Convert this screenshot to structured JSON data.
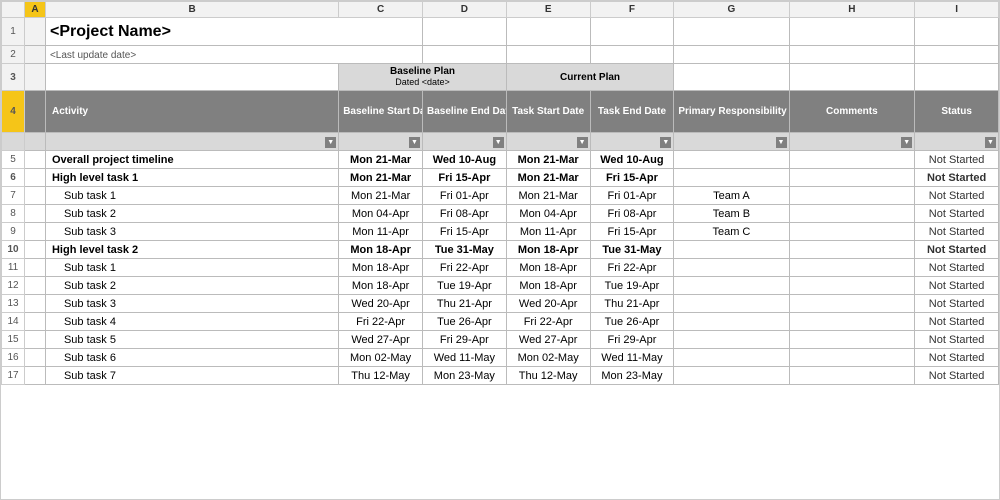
{
  "title": "<Project Name>",
  "lastUpdate": "<Last update date>",
  "headers": {
    "colA": "A",
    "colB": "B",
    "colC": "C",
    "colD": "D",
    "colE": "E",
    "colF": "F",
    "colG": "G",
    "colH": "H",
    "colI": "I"
  },
  "planHeaders": {
    "baselinePlan": "Baseline Plan",
    "baselineDated": "Dated <date>",
    "currentPlan": "Current Plan"
  },
  "columnHeaders": {
    "activity": "Activity",
    "baselineStart": "Baseline Start Date",
    "baselineEnd": "Baseline End Date",
    "taskStart": "Task Start Date",
    "taskEnd": "Task End Date",
    "primaryResp": "Primary Responsibility",
    "comments": "Comments",
    "status": "Status"
  },
  "rows": [
    {
      "num": "5",
      "activity": "Overall project timeline",
      "baselineStart": "Mon 21-Mar",
      "baselineEnd": "Wed 10-Aug",
      "taskStart": "Mon 21-Mar",
      "taskEnd": "Wed 10-Aug",
      "responsibility": "",
      "comments": "",
      "status": "Not Started",
      "type": "overall"
    },
    {
      "num": "6",
      "activity": "High level task 1",
      "baselineStart": "Mon 21-Mar",
      "baselineEnd": "Fri 15-Apr",
      "taskStart": "Mon 21-Mar",
      "taskEnd": "Fri 15-Apr",
      "responsibility": "",
      "comments": "",
      "status": "Not Started",
      "type": "highlevel"
    },
    {
      "num": "7",
      "activity": "Sub task 1",
      "baselineStart": "Mon 21-Mar",
      "baselineEnd": "Fri 01-Apr",
      "taskStart": "Mon 21-Mar",
      "taskEnd": "Fri 01-Apr",
      "responsibility": "Team A",
      "comments": "",
      "status": "Not Started",
      "type": "subtask"
    },
    {
      "num": "8",
      "activity": "Sub task 2",
      "baselineStart": "Mon 04-Apr",
      "baselineEnd": "Fri 08-Apr",
      "taskStart": "Mon 04-Apr",
      "taskEnd": "Fri 08-Apr",
      "responsibility": "Team B",
      "comments": "",
      "status": "Not Started",
      "type": "subtask"
    },
    {
      "num": "9",
      "activity": "Sub task 3",
      "baselineStart": "Mon 11-Apr",
      "baselineEnd": "Fri 15-Apr",
      "taskStart": "Mon 11-Apr",
      "taskEnd": "Fri 15-Apr",
      "responsibility": "Team C",
      "comments": "",
      "status": "Not Started",
      "type": "subtask"
    },
    {
      "num": "10",
      "activity": "High level task 2",
      "baselineStart": "Mon 18-Apr",
      "baselineEnd": "Tue 31-May",
      "taskStart": "Mon 18-Apr",
      "taskEnd": "Tue 31-May",
      "responsibility": "",
      "comments": "",
      "status": "Not Started",
      "type": "highlevel"
    },
    {
      "num": "11",
      "activity": "Sub task 1",
      "baselineStart": "Mon 18-Apr",
      "baselineEnd": "Fri 22-Apr",
      "taskStart": "Mon 18-Apr",
      "taskEnd": "Fri 22-Apr",
      "responsibility": "",
      "comments": "",
      "status": "Not Started",
      "type": "subtask"
    },
    {
      "num": "12",
      "activity": "Sub task 2",
      "baselineStart": "Mon 18-Apr",
      "baselineEnd": "Tue 19-Apr",
      "taskStart": "Mon 18-Apr",
      "taskEnd": "Tue 19-Apr",
      "responsibility": "",
      "comments": "",
      "status": "Not Started",
      "type": "subtask"
    },
    {
      "num": "13",
      "activity": "Sub task 3",
      "baselineStart": "Wed 20-Apr",
      "baselineEnd": "Thu 21-Apr",
      "taskStart": "Wed 20-Apr",
      "taskEnd": "Thu 21-Apr",
      "responsibility": "",
      "comments": "",
      "status": "Not Started",
      "type": "subtask"
    },
    {
      "num": "14",
      "activity": "Sub task 4",
      "baselineStart": "Fri 22-Apr",
      "baselineEnd": "Tue 26-Apr",
      "taskStart": "Fri 22-Apr",
      "taskEnd": "Tue 26-Apr",
      "responsibility": "",
      "comments": "",
      "status": "Not Started",
      "type": "subtask"
    },
    {
      "num": "15",
      "activity": "Sub task 5",
      "baselineStart": "Wed 27-Apr",
      "baselineEnd": "Fri 29-Apr",
      "taskStart": "Wed 27-Apr",
      "taskEnd": "Fri 29-Apr",
      "responsibility": "",
      "comments": "",
      "status": "Not Started",
      "type": "subtask"
    },
    {
      "num": "16",
      "activity": "Sub task 6",
      "baselineStart": "Mon 02-May",
      "baselineEnd": "Wed 11-May",
      "taskStart": "Mon 02-May",
      "taskEnd": "Wed 11-May",
      "responsibility": "",
      "comments": "",
      "status": "Not Started",
      "type": "subtask"
    },
    {
      "num": "17",
      "activity": "Sub task 7",
      "baselineStart": "Thu 12-May",
      "baselineEnd": "Mon 23-May",
      "taskStart": "Thu 12-May",
      "taskEnd": "Mon 23-May",
      "responsibility": "",
      "comments": "",
      "status": "Not Started",
      "type": "subtask"
    }
  ],
  "statusLabel": "Not Started"
}
